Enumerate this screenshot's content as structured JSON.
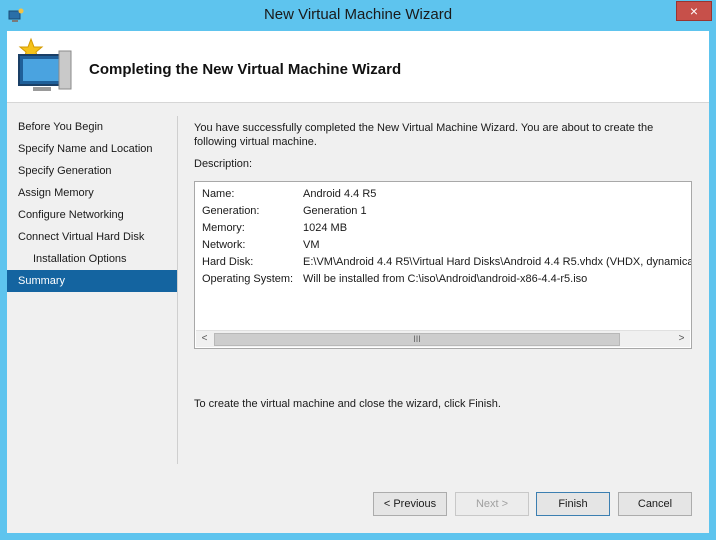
{
  "window": {
    "title": "New Virtual Machine Wizard",
    "close_glyph": "×",
    "app_icon": "hyper-v-manager-icon"
  },
  "header": {
    "title": "Completing the New Virtual Machine Wizard",
    "icon": "new-vm-wizard-icon"
  },
  "nav": {
    "items": [
      {
        "label": "Before You Begin",
        "sub": false,
        "selected": false
      },
      {
        "label": "Specify Name and Location",
        "sub": false,
        "selected": false
      },
      {
        "label": "Specify Generation",
        "sub": false,
        "selected": false
      },
      {
        "label": "Assign Memory",
        "sub": false,
        "selected": false
      },
      {
        "label": "Configure Networking",
        "sub": false,
        "selected": false
      },
      {
        "label": "Connect Virtual Hard Disk",
        "sub": false,
        "selected": false
      },
      {
        "label": "Installation Options",
        "sub": true,
        "selected": false
      },
      {
        "label": "Summary",
        "sub": false,
        "selected": true
      }
    ]
  },
  "content": {
    "intro": "You have successfully completed the New Virtual Machine Wizard. You are about to create the following virtual machine.",
    "description_label": "Description:",
    "description": [
      {
        "key": "Name:",
        "value": "Android 4.4 R5"
      },
      {
        "key": "Generation:",
        "value": "Generation 1"
      },
      {
        "key": "Memory:",
        "value": "1024 MB"
      },
      {
        "key": "Network:",
        "value": "VM"
      },
      {
        "key": "Hard Disk:",
        "value": "E:\\VM\\Android 4.4 R5\\Virtual Hard Disks\\Android 4.4 R5.vhdx (VHDX, dynamically"
      },
      {
        "key": "Operating System:",
        "value": "Will be installed from C:\\iso\\Android\\android-x86-4.4-r5.iso"
      }
    ],
    "scroll_left": "<",
    "scroll_right": ">",
    "scroll_thumb_grip": "III",
    "finish_note": "To create the virtual machine and close the wizard, click Finish."
  },
  "buttons": {
    "previous": "< Previous",
    "next": "Next >",
    "finish": "Finish",
    "cancel": "Cancel"
  },
  "colors": {
    "titlebar": "#5ec4ee",
    "selection": "#1464a0",
    "close": "#c7504a"
  }
}
